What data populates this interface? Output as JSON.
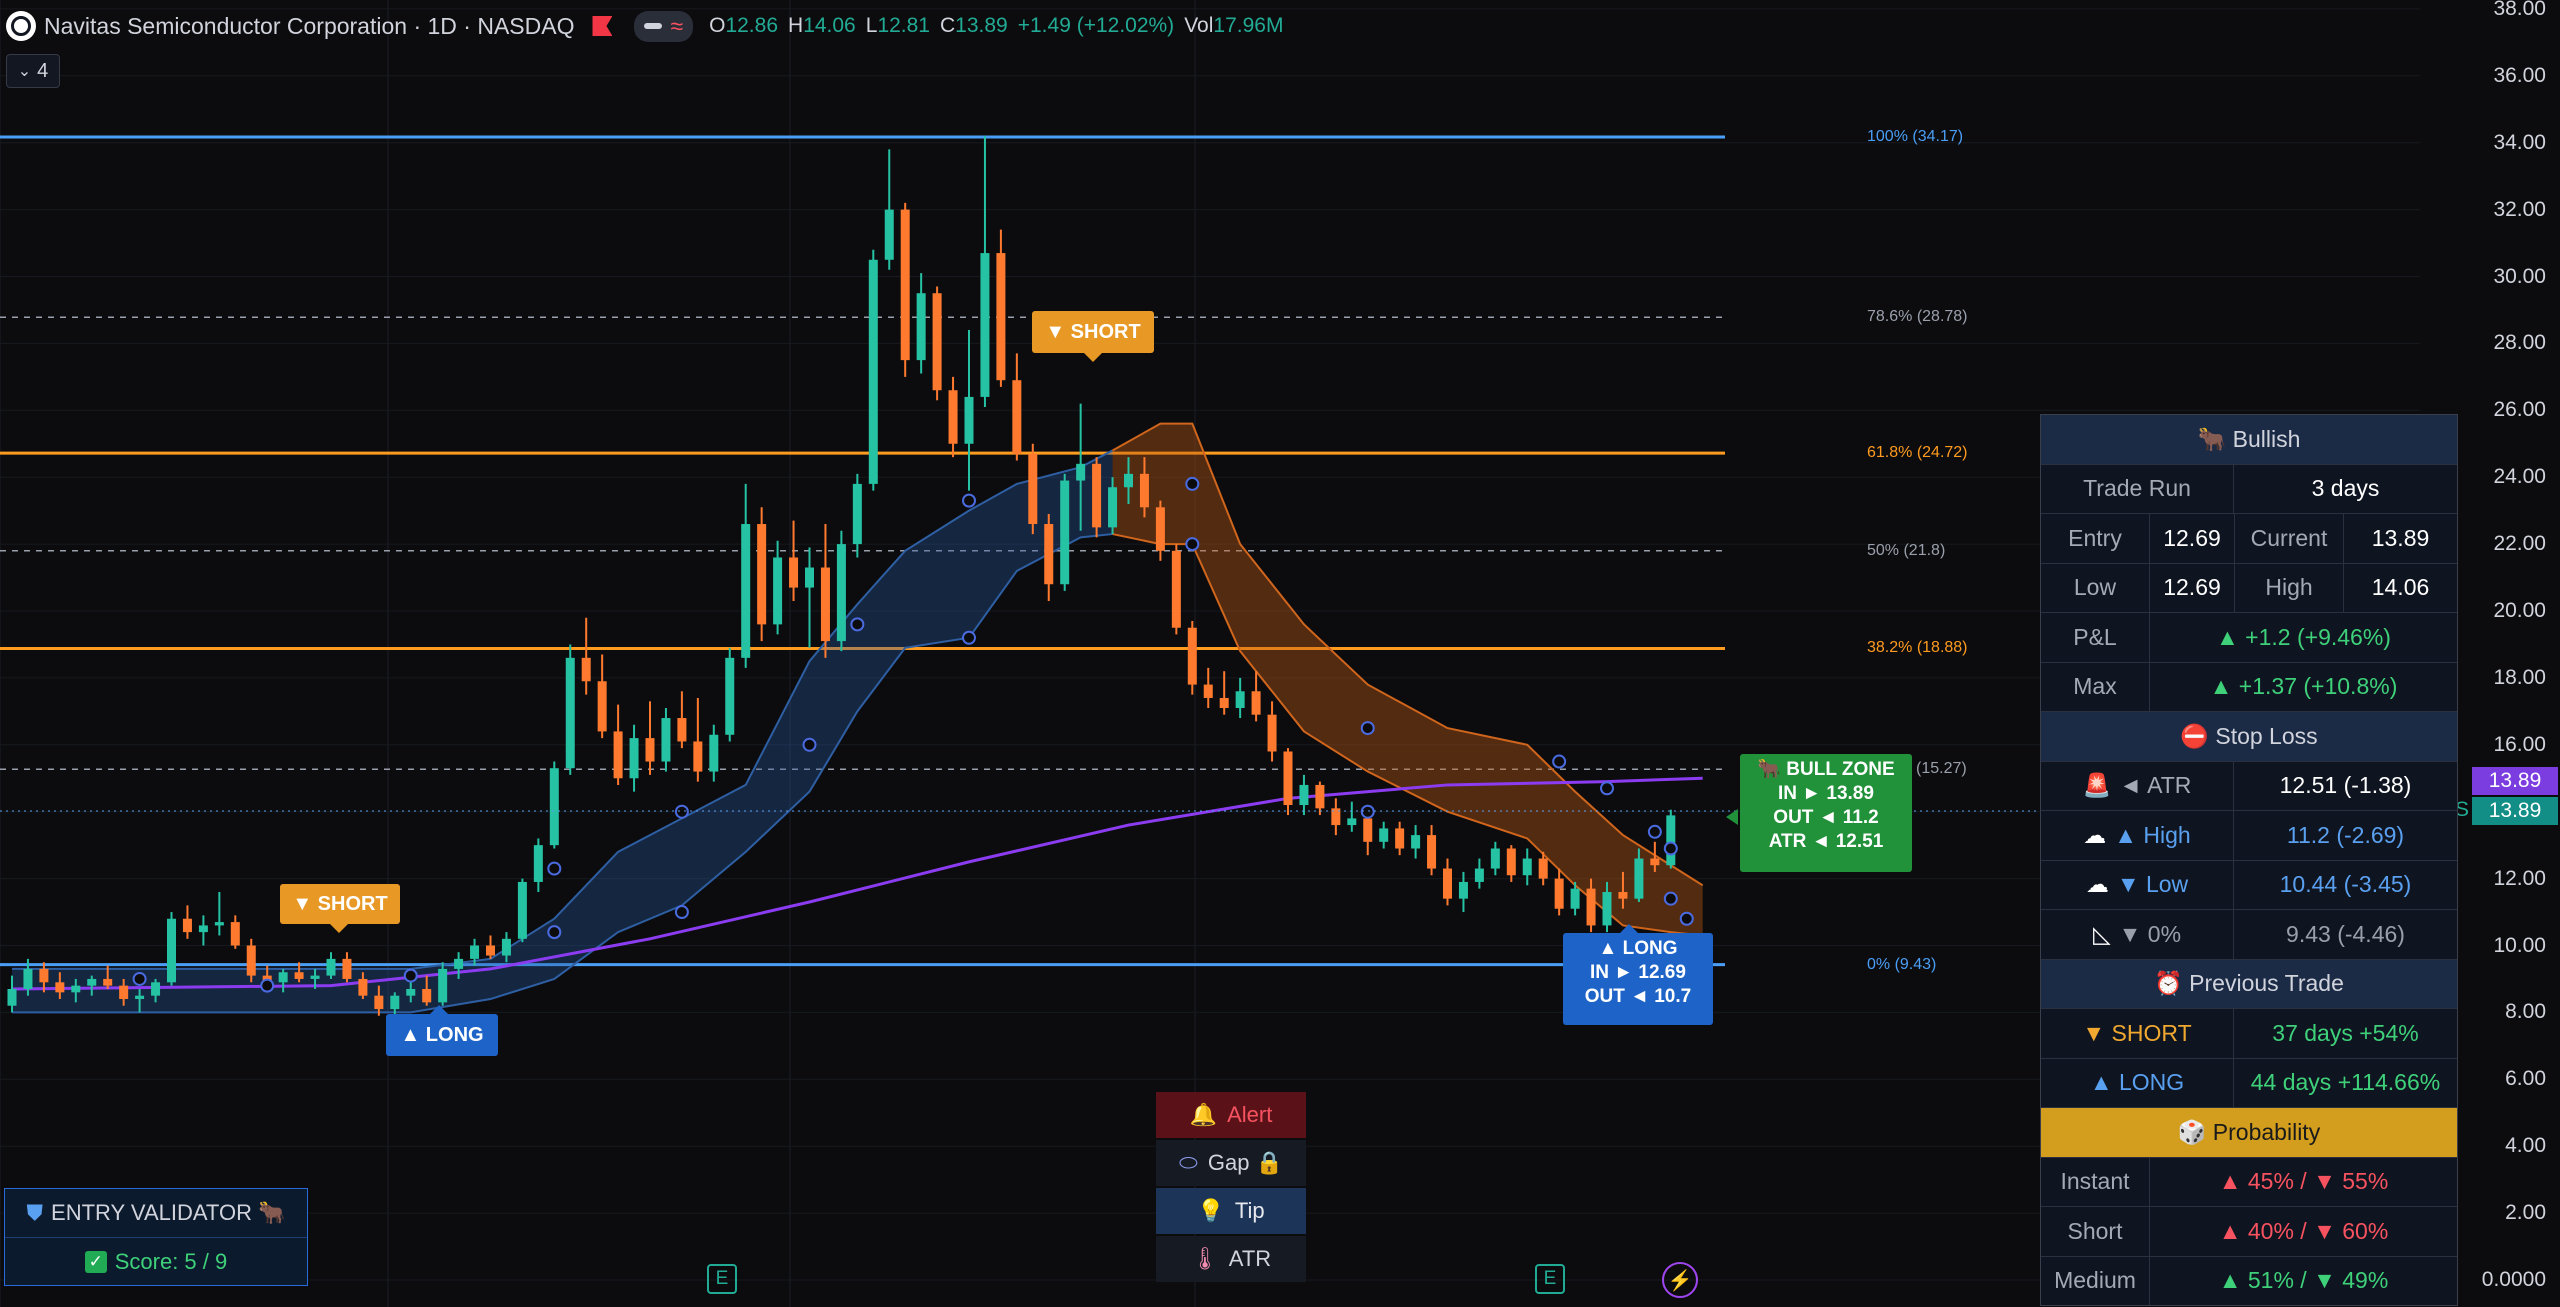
{
  "header": {
    "title": "Navitas Semiconductor Corporation · 1D · NASDAQ",
    "o_label": "O",
    "o": "12.86",
    "h_label": "H",
    "h": "14.06",
    "l_label": "L",
    "l": "12.81",
    "c_label": "C",
    "c": "13.89",
    "change": "+1.49 (+12.02%)",
    "vol_label": "Vol",
    "vol": "17.96M",
    "indicator_count": "4"
  },
  "colors": {
    "up": "#22ab94",
    "down": "#f7525f",
    "fib_blue": "#4a9ef5",
    "fib_orange": "#ff9b1f",
    "ma": "#8b3cf0",
    "bull": "#21913a",
    "long": "#1e64c8",
    "short": "#e89824"
  },
  "price_axis": {
    "ticks": [
      "38.00",
      "36.00",
      "34.00",
      "32.00",
      "30.00",
      "28.00",
      "26.00",
      "24.00",
      "22.00",
      "20.00",
      "18.00",
      "16.00",
      "14.00",
      "12.00",
      "10.00",
      "8.00",
      "6.00",
      "4.00",
      "2.00",
      "0.0000"
    ],
    "last_price": "13.89",
    "last_price_ma": "13.89",
    "s_marker": "S"
  },
  "fib_levels": [
    {
      "label": "100% (34.17)",
      "price": 34.17,
      "color": "#4a9ef5",
      "style": "solid"
    },
    {
      "label": "78.6% (28.78)",
      "price": 28.78,
      "color": "#9aa0ab",
      "style": "dashed"
    },
    {
      "label": "61.8% (24.72)",
      "price": 24.72,
      "color": "#ff9b1f",
      "style": "solid"
    },
    {
      "label": "50% (21.8)",
      "price": 21.8,
      "color": "#9aa0ab",
      "style": "dashed"
    },
    {
      "label": "38.2% (18.88)",
      "price": 18.88,
      "color": "#ff9b1f",
      "style": "solid"
    },
    {
      "label": "(15.27)",
      "price": 15.27,
      "color": "#9aa0ab",
      "style": "dashed"
    },
    {
      "label": "0% (9.43)",
      "price": 9.43,
      "color": "#4a9ef5",
      "style": "solid"
    }
  ],
  "signals": {
    "short1": "▼ SHORT",
    "short2": "▼ SHORT",
    "long1": "▲ LONG",
    "bull_zone": {
      "title": "🐂 BULL ZONE",
      "in": "IN ► 13.89",
      "out": "OUT ◄ 11.2",
      "atr": "ATR ◄ 12.51"
    },
    "long_box": {
      "title": "▲ LONG",
      "in": "IN ► 12.69",
      "out": "OUT ◄ 10.7"
    }
  },
  "panel": {
    "title": "🐂 Bullish",
    "trade_run_label": "Trade Run",
    "trade_run": "3 days",
    "entry_label": "Entry",
    "entry": "12.69",
    "current_label": "Current",
    "current": "13.89",
    "low_label": "Low",
    "low": "12.69",
    "high_label": "High",
    "high": "14.06",
    "pnl_label": "P&L",
    "pnl": "▲ +1.2  (+9.46%)",
    "max_label": "Max",
    "max": "▲ +1.37  (+10.8%)",
    "stop_title": "⛔ Stop Loss",
    "atr_icon": "🚨",
    "atr_label": "◄ ATR",
    "atr": "12.51  (-1.38)",
    "sh_icon": "☁",
    "sh_label": "▲ High",
    "sh": "11.2  (-2.69)",
    "sl_icon": "☁",
    "sl_label": "▼ Low",
    "sl": "10.44  (-3.45)",
    "s0_icon": "◺",
    "s0_label": "▼ 0%",
    "s0": "9.43  (-4.46)",
    "prev_title": "⏰ Previous Trade",
    "prev_short_label": "▼ SHORT",
    "prev_short": "37 days  +54%",
    "prev_long_label": "▲ LONG",
    "prev_long": "44 days  +114.66%",
    "prob_title": "🎲 Probability",
    "instant_label": "Instant",
    "instant": "▲ 45%  /  ▼ 55%",
    "short_label": "Short",
    "short": "▲ 40%  /  ▼ 60%",
    "medium_label": "Medium",
    "medium": "▲ 51%  /  ▼ 49%"
  },
  "validator": {
    "title": "ENTRY VALIDATOR 🐂",
    "score": "Score: 5 / 9"
  },
  "menu": {
    "alert": "Alert",
    "gap": "Gap 🔒",
    "tip": "Tip",
    "atr": "ATR"
  },
  "earnings_marker": "E",
  "candles": [
    [
      8.2,
      9.1,
      8.0,
      8.7
    ],
    [
      8.7,
      9.6,
      8.5,
      9.3
    ],
    [
      9.3,
      9.5,
      8.6,
      8.9
    ],
    [
      8.9,
      9.2,
      8.4,
      8.6
    ],
    [
      8.6,
      9.0,
      8.3,
      8.8
    ],
    [
      8.8,
      9.1,
      8.5,
      9.0
    ],
    [
      9.0,
      9.4,
      8.7,
      8.8
    ],
    [
      8.8,
      9.0,
      8.2,
      8.4
    ],
    [
      8.4,
      8.7,
      8.0,
      8.5
    ],
    [
      8.5,
      9.0,
      8.3,
      8.9
    ],
    [
      8.9,
      11.0,
      8.8,
      10.8
    ],
    [
      10.8,
      11.2,
      10.2,
      10.4
    ],
    [
      10.4,
      10.9,
      10.0,
      10.6
    ],
    [
      10.6,
      11.6,
      10.3,
      10.7
    ],
    [
      10.7,
      10.9,
      9.9,
      10.0
    ],
    [
      10.0,
      10.2,
      8.9,
      9.1
    ],
    [
      9.1,
      9.4,
      8.7,
      8.9
    ],
    [
      8.9,
      9.3,
      8.6,
      9.2
    ],
    [
      9.2,
      9.5,
      8.9,
      9.0
    ],
    [
      9.0,
      9.3,
      8.7,
      9.1
    ],
    [
      9.1,
      9.8,
      9.0,
      9.6
    ],
    [
      9.6,
      9.8,
      8.9,
      9.0
    ],
    [
      9.0,
      9.2,
      8.4,
      8.5
    ],
    [
      8.5,
      8.8,
      7.9,
      8.1
    ],
    [
      8.1,
      8.6,
      7.9,
      8.5
    ],
    [
      8.5,
      9.0,
      8.3,
      8.7
    ],
    [
      8.7,
      9.1,
      8.2,
      8.3
    ],
    [
      8.3,
      9.5,
      8.2,
      9.3
    ],
    [
      9.3,
      9.8,
      9.0,
      9.6
    ],
    [
      9.6,
      10.2,
      9.4,
      10.0
    ],
    [
      10.0,
      10.3,
      9.6,
      9.7
    ],
    [
      9.7,
      10.4,
      9.5,
      10.2
    ],
    [
      10.2,
      12.0,
      10.1,
      11.9
    ],
    [
      11.9,
      13.2,
      11.6,
      13.0
    ],
    [
      13.0,
      15.5,
      12.9,
      15.3
    ],
    [
      15.3,
      19.0,
      15.1,
      18.6
    ],
    [
      18.6,
      19.8,
      17.5,
      17.9
    ],
    [
      17.9,
      18.7,
      16.2,
      16.4
    ],
    [
      16.4,
      17.2,
      14.8,
      15.0
    ],
    [
      15.0,
      16.6,
      14.6,
      16.2
    ],
    [
      16.2,
      17.3,
      15.1,
      15.5
    ],
    [
      15.5,
      17.1,
      15.2,
      16.8
    ],
    [
      16.8,
      17.6,
      15.9,
      16.1
    ],
    [
      16.1,
      17.4,
      14.9,
      15.2
    ],
    [
      15.2,
      16.6,
      14.9,
      16.3
    ],
    [
      16.3,
      18.9,
      16.1,
      18.6
    ],
    [
      18.6,
      23.8,
      18.3,
      22.6
    ],
    [
      22.6,
      23.1,
      19.1,
      19.6
    ],
    [
      19.6,
      22.1,
      19.3,
      21.6
    ],
    [
      21.6,
      22.7,
      20.3,
      20.7
    ],
    [
      20.7,
      21.9,
      18.9,
      21.3
    ],
    [
      21.3,
      22.6,
      18.6,
      19.1
    ],
    [
      19.1,
      22.4,
      18.8,
      22.0
    ],
    [
      22.0,
      24.1,
      21.6,
      23.8
    ],
    [
      23.8,
      30.8,
      23.6,
      30.5
    ],
    [
      30.5,
      33.8,
      30.2,
      32.0
    ],
    [
      32.0,
      32.2,
      27.0,
      27.5
    ],
    [
      27.5,
      30.1,
      27.1,
      29.5
    ],
    [
      29.5,
      29.7,
      26.3,
      26.6
    ],
    [
      26.6,
      27.0,
      24.6,
      25.0
    ],
    [
      25.0,
      28.4,
      23.6,
      26.4
    ],
    [
      26.4,
      34.2,
      26.1,
      30.7
    ],
    [
      30.7,
      31.4,
      26.7,
      26.9
    ],
    [
      26.9,
      27.7,
      24.5,
      24.7
    ],
    [
      24.7,
      25.0,
      22.3,
      22.6
    ],
    [
      22.6,
      22.9,
      20.3,
      20.8
    ],
    [
      20.8,
      24.1,
      20.6,
      23.9
    ],
    [
      23.9,
      26.2,
      22.4,
      24.4
    ],
    [
      24.4,
      24.6,
      22.2,
      22.5
    ],
    [
      22.5,
      24.0,
      22.3,
      23.7
    ],
    [
      23.7,
      24.6,
      23.2,
      24.1
    ],
    [
      24.1,
      24.6,
      22.8,
      23.1
    ],
    [
      23.1,
      23.3,
      21.5,
      21.8
    ],
    [
      21.8,
      22.0,
      19.3,
      19.5
    ],
    [
      19.5,
      19.7,
      17.5,
      17.8
    ],
    [
      17.8,
      18.3,
      17.1,
      17.4
    ],
    [
      17.4,
      18.2,
      16.9,
      17.1
    ],
    [
      17.1,
      18.0,
      16.8,
      17.6
    ],
    [
      17.6,
      18.2,
      16.7,
      16.9
    ],
    [
      16.9,
      17.3,
      15.5,
      15.8
    ],
    [
      15.8,
      15.9,
      13.9,
      14.2
    ],
    [
      14.2,
      15.1,
      13.9,
      14.8
    ],
    [
      14.8,
      14.9,
      13.9,
      14.1
    ],
    [
      14.1,
      14.4,
      13.3,
      13.6
    ],
    [
      13.6,
      14.3,
      13.4,
      13.8
    ],
    [
      13.8,
      13.9,
      12.7,
      13.1
    ],
    [
      13.1,
      13.7,
      12.9,
      13.5
    ],
    [
      13.5,
      13.7,
      12.7,
      12.9
    ],
    [
      12.9,
      13.6,
      12.6,
      13.3
    ],
    [
      13.3,
      13.6,
      12.1,
      12.3
    ],
    [
      12.3,
      12.6,
      11.2,
      11.4
    ],
    [
      11.4,
      12.2,
      11.0,
      11.9
    ],
    [
      11.9,
      12.6,
      11.7,
      12.3
    ],
    [
      12.3,
      13.1,
      12.1,
      12.9
    ],
    [
      12.9,
      13.0,
      11.9,
      12.1
    ],
    [
      12.1,
      12.9,
      11.8,
      12.6
    ],
    [
      12.6,
      12.8,
      11.8,
      12.0
    ],
    [
      12.0,
      12.3,
      10.9,
      11.1
    ],
    [
      11.1,
      11.9,
      10.9,
      11.7
    ],
    [
      11.7,
      12.0,
      10.4,
      10.6
    ],
    [
      10.6,
      11.9,
      10.4,
      11.6
    ],
    [
      11.6,
      12.2,
      11.1,
      11.4
    ],
    [
      11.4,
      12.9,
      11.3,
      12.6
    ],
    [
      12.6,
      13.1,
      12.2,
      12.4
    ],
    [
      12.4,
      14.06,
      12.3,
      13.89
    ]
  ],
  "band_upper": [
    [
      0,
      9.3
    ],
    [
      25,
      9.3
    ],
    [
      30,
      9.6
    ],
    [
      34,
      10.8
    ],
    [
      38,
      12.8
    ],
    [
      42,
      13.8
    ],
    [
      46,
      14.8
    ],
    [
      50,
      18.5
    ],
    [
      53,
      20.2
    ],
    [
      56,
      21.8
    ],
    [
      60,
      23.0
    ],
    [
      63,
      23.8
    ],
    [
      67,
      24.3
    ],
    [
      69,
      24.8
    ],
    [
      72,
      25.6
    ],
    [
      74,
      25.6
    ],
    [
      77,
      22.0
    ],
    [
      81,
      19.6
    ],
    [
      85,
      17.8
    ],
    [
      90,
      16.5
    ],
    [
      95,
      16.0
    ],
    [
      98,
      14.6
    ],
    [
      101,
      13.3
    ],
    [
      104,
      12.4
    ],
    [
      106,
      11.8
    ]
  ],
  "band_lower": [
    [
      0,
      8.0
    ],
    [
      25,
      8.0
    ],
    [
      30,
      8.4
    ],
    [
      34,
      9.0
    ],
    [
      38,
      10.4
    ],
    [
      42,
      11.2
    ],
    [
      46,
      12.8
    ],
    [
      50,
      14.6
    ],
    [
      53,
      17.0
    ],
    [
      56,
      18.9
    ],
    [
      60,
      19.2
    ],
    [
      63,
      21.2
    ],
    [
      67,
      22.2
    ],
    [
      69,
      22.3
    ],
    [
      72,
      22.0
    ],
    [
      74,
      22.0
    ],
    [
      77,
      18.8
    ],
    [
      81,
      16.4
    ],
    [
      85,
      15.2
    ],
    [
      90,
      14.0
    ],
    [
      95,
      13.2
    ],
    [
      98,
      11.8
    ],
    [
      101,
      10.6
    ],
    [
      104,
      10.4
    ],
    [
      106,
      10.3
    ]
  ],
  "ma_line": [
    [
      0,
      8.7
    ],
    [
      20,
      8.8
    ],
    [
      30,
      9.3
    ],
    [
      40,
      10.2
    ],
    [
      50,
      11.3
    ],
    [
      60,
      12.5
    ],
    [
      70,
      13.6
    ],
    [
      80,
      14.4
    ],
    [
      90,
      14.8
    ],
    [
      100,
      14.9
    ],
    [
      106,
      15.0
    ]
  ]
}
